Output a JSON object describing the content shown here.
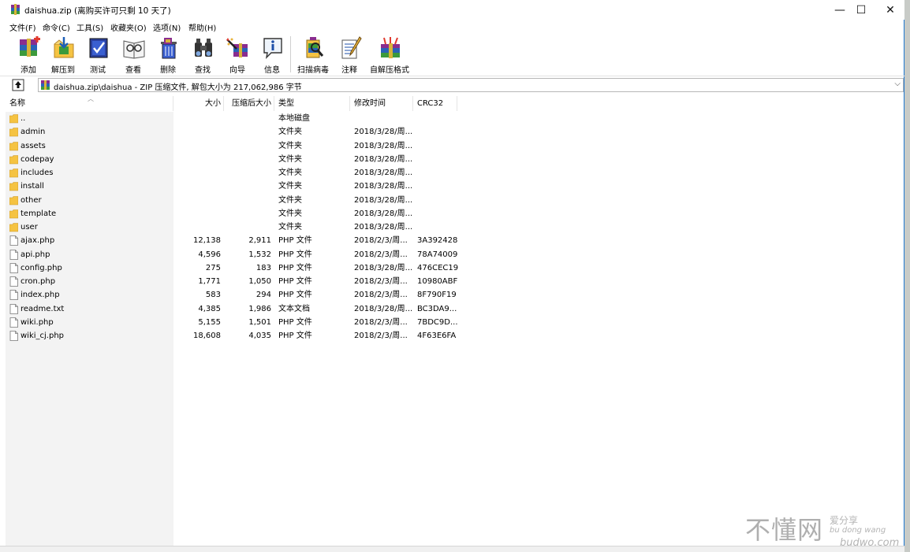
{
  "window": {
    "title": "daishua.zip (离购买许可只剩 10 天了)"
  },
  "window_controls": {
    "minimize": "—",
    "maximize": "☐",
    "close": "✕"
  },
  "menu": [
    "文件(F)",
    "命令(C)",
    "工具(S)",
    "收藏夹(O)",
    "选项(N)",
    "帮助(H)"
  ],
  "toolbar": [
    {
      "label": "添加",
      "icon": "add-archive-icon"
    },
    {
      "label": "解压到",
      "icon": "extract-to-icon"
    },
    {
      "label": "测试",
      "icon": "test-icon"
    },
    {
      "label": "查看",
      "icon": "view-icon"
    },
    {
      "label": "删除",
      "icon": "delete-icon"
    },
    {
      "label": "查找",
      "icon": "find-icon"
    },
    {
      "label": "向导",
      "icon": "wizard-icon"
    },
    {
      "label": "信息",
      "icon": "info-icon"
    },
    {
      "label": "扫描病毒",
      "icon": "virus-scan-icon"
    },
    {
      "label": "注释",
      "icon": "comment-icon"
    },
    {
      "label": "自解压格式",
      "icon": "sfx-icon"
    }
  ],
  "address": {
    "path": "daishua.zip\\daishua - ZIP 压缩文件, 解包大小为 217,062,986 字节"
  },
  "columns": {
    "name": "名称",
    "size": "大小",
    "packed": "压缩后大小",
    "type": "类型",
    "modified": "修改时间",
    "crc": "CRC32"
  },
  "rows": [
    {
      "name": "..",
      "size": "",
      "packed": "",
      "type": "本地磁盘",
      "modified": "",
      "crc": "",
      "kind": "folder"
    },
    {
      "name": "admin",
      "size": "",
      "packed": "",
      "type": "文件夹",
      "modified": "2018/3/28/周...",
      "crc": "",
      "kind": "folder"
    },
    {
      "name": "assets",
      "size": "",
      "packed": "",
      "type": "文件夹",
      "modified": "2018/3/28/周...",
      "crc": "",
      "kind": "folder"
    },
    {
      "name": "codepay",
      "size": "",
      "packed": "",
      "type": "文件夹",
      "modified": "2018/3/28/周...",
      "crc": "",
      "kind": "folder"
    },
    {
      "name": "includes",
      "size": "",
      "packed": "",
      "type": "文件夹",
      "modified": "2018/3/28/周...",
      "crc": "",
      "kind": "folder"
    },
    {
      "name": "install",
      "size": "",
      "packed": "",
      "type": "文件夹",
      "modified": "2018/3/28/周...",
      "crc": "",
      "kind": "folder"
    },
    {
      "name": "other",
      "size": "",
      "packed": "",
      "type": "文件夹",
      "modified": "2018/3/28/周...",
      "crc": "",
      "kind": "folder"
    },
    {
      "name": "template",
      "size": "",
      "packed": "",
      "type": "文件夹",
      "modified": "2018/3/28/周...",
      "crc": "",
      "kind": "folder"
    },
    {
      "name": "user",
      "size": "",
      "packed": "",
      "type": "文件夹",
      "modified": "2018/3/28/周...",
      "crc": "",
      "kind": "folder"
    },
    {
      "name": "ajax.php",
      "size": "12,138",
      "packed": "2,911",
      "type": "PHP 文件",
      "modified": "2018/2/3/周...",
      "crc": "3A392428",
      "kind": "file"
    },
    {
      "name": "api.php",
      "size": "4,596",
      "packed": "1,532",
      "type": "PHP 文件",
      "modified": "2018/2/3/周...",
      "crc": "78A74009",
      "kind": "file"
    },
    {
      "name": "config.php",
      "size": "275",
      "packed": "183",
      "type": "PHP 文件",
      "modified": "2018/3/28/周...",
      "crc": "476CEC19",
      "kind": "file"
    },
    {
      "name": "cron.php",
      "size": "1,771",
      "packed": "1,050",
      "type": "PHP 文件",
      "modified": "2018/2/3/周...",
      "crc": "10980ABF",
      "kind": "file"
    },
    {
      "name": "index.php",
      "size": "583",
      "packed": "294",
      "type": "PHP 文件",
      "modified": "2018/2/3/周...",
      "crc": "8F790F19",
      "kind": "file"
    },
    {
      "name": "readme.txt",
      "size": "4,385",
      "packed": "1,986",
      "type": "文本文档",
      "modified": "2018/3/28/周...",
      "crc": "BC3DA9...",
      "kind": "file"
    },
    {
      "name": "wiki.php",
      "size": "5,155",
      "packed": "1,501",
      "type": "PHP 文件",
      "modified": "2018/2/3/周...",
      "crc": "7BDC9D...",
      "kind": "file"
    },
    {
      "name": "wiki_cj.php",
      "size": "18,608",
      "packed": "4,035",
      "type": "PHP 文件",
      "modified": "2018/2/3/周...",
      "crc": "4F63E6FA",
      "kind": "file"
    }
  ],
  "watermark": {
    "big": "不懂网",
    "small": "爱分享",
    "pinyin": "bu dong wang",
    "domain": "budwo.com"
  },
  "colors": {
    "folder": "#f5c342",
    "accent": "#1f78d1",
    "name_column_bg": "#f3f3f3"
  }
}
